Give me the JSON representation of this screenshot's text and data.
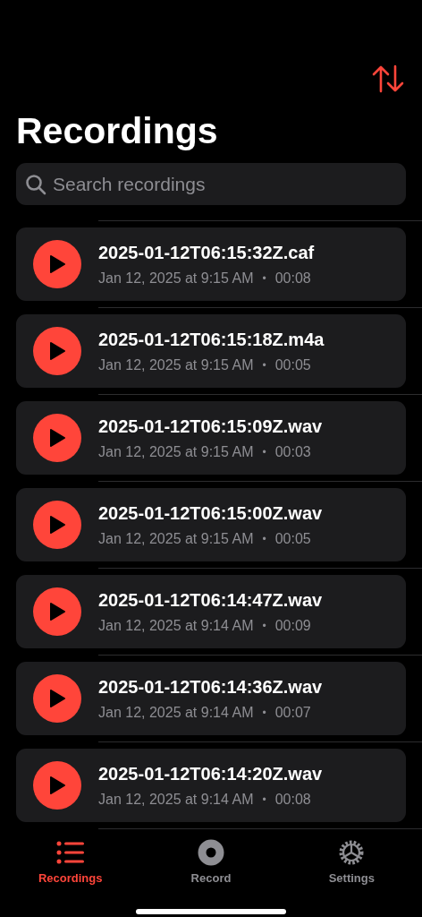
{
  "title": "Recordings",
  "search": {
    "placeholder": "Search recordings"
  },
  "recordings": [
    {
      "name": "2025-01-12T06:15:32Z.caf",
      "date": "Jan 12, 2025 at 9:15 AM",
      "separator": "•",
      "duration": "00:08"
    },
    {
      "name": "2025-01-12T06:15:18Z.m4a",
      "date": "Jan 12, 2025 at 9:15 AM",
      "separator": "•",
      "duration": "00:05"
    },
    {
      "name": "2025-01-12T06:15:09Z.wav",
      "date": "Jan 12, 2025 at 9:15 AM",
      "separator": "•",
      "duration": "00:03"
    },
    {
      "name": "2025-01-12T06:15:00Z.wav",
      "date": "Jan 12, 2025 at 9:15 AM",
      "separator": "•",
      "duration": "00:05"
    },
    {
      "name": "2025-01-12T06:14:47Z.wav",
      "date": "Jan 12, 2025 at 9:14 AM",
      "separator": "•",
      "duration": "00:09"
    },
    {
      "name": "2025-01-12T06:14:36Z.wav",
      "date": "Jan 12, 2025 at 9:14 AM",
      "separator": "•",
      "duration": "00:07"
    },
    {
      "name": "2025-01-12T06:14:20Z.wav",
      "date": "Jan 12, 2025 at 9:14 AM",
      "separator": "•",
      "duration": "00:08"
    }
  ],
  "tab_bar": [
    {
      "kind": "list",
      "label": "Recordings",
      "selected": true
    },
    {
      "kind": "record",
      "label": "Record",
      "selected": false
    },
    {
      "kind": "settings",
      "label": "Settings",
      "selected": false
    }
  ]
}
